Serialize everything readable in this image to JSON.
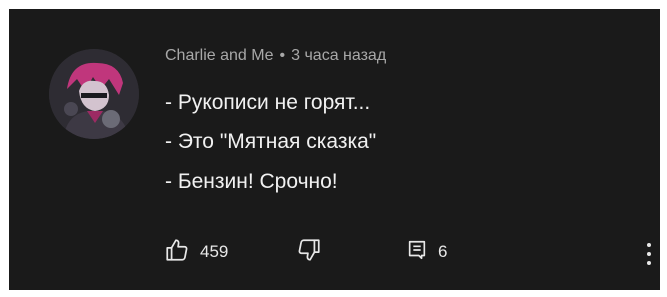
{
  "comment": {
    "author": "Charlie and Me",
    "separator": "•",
    "time": "3 часа назад",
    "lines": [
      "- Рукописи не горят...",
      "- Это \"Мятная сказка\"",
      "- Бензин! Срочно!"
    ]
  },
  "actions": {
    "like_count": "459",
    "reply_count": "6"
  },
  "icons": {
    "like": "thumbs-up-icon",
    "dislike": "thumbs-down-icon",
    "replies": "comment-icon",
    "more": "more-vertical-icon"
  },
  "colors": {
    "background": "#1a1a1a",
    "text": "#f1f1f1",
    "meta": "#a8a8a8",
    "avatar_accent": "#c0367c"
  }
}
